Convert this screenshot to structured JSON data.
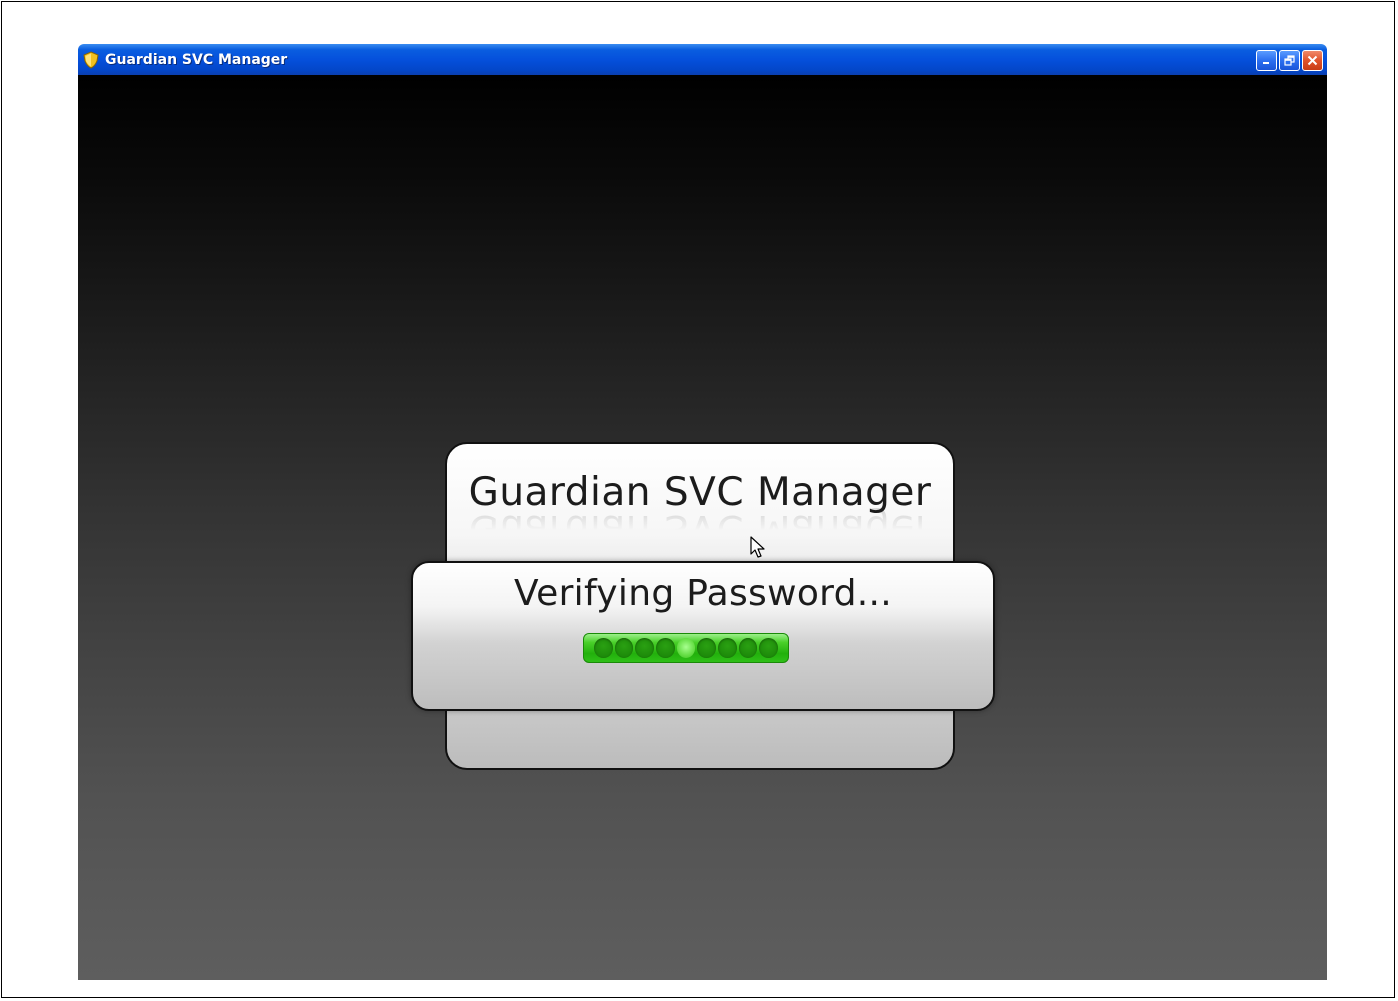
{
  "window": {
    "title": "Guardian SVC Manager",
    "buttons": [
      "minimize",
      "restore",
      "close"
    ]
  },
  "splash": {
    "title": "Guardian SVC Manager",
    "status": "Verifying Password..."
  },
  "progress": {
    "dot_count": 9,
    "lit_dot_index": 4
  },
  "colors": {
    "titlebar": "#0550dc",
    "progress_green": "#22b00c",
    "close_button": "#e0522a"
  },
  "icons": {
    "title_icon": "shield-icon",
    "cursor": "mouse-pointer-icon"
  }
}
